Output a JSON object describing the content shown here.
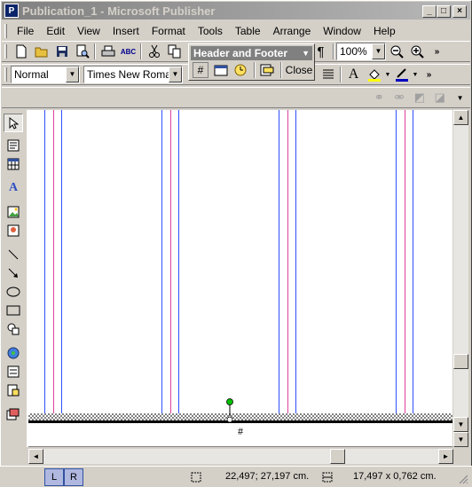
{
  "window": {
    "title": "Publication_1 - Microsoft Publisher",
    "app_icon": "publisher-icon",
    "controls": [
      "minimize",
      "maximize",
      "close"
    ]
  },
  "menu": [
    "File",
    "Edit",
    "View",
    "Insert",
    "Format",
    "Tools",
    "Table",
    "Arrange",
    "Window",
    "Help"
  ],
  "standard_toolbar": {
    "icons": [
      "new-icon",
      "open-icon",
      "save-icon",
      "print-preview-icon",
      "print-icon",
      "spelling-icon",
      "cut-icon",
      "copy-icon"
    ],
    "pilcrow": "¶",
    "zoom": "100%"
  },
  "formatting_toolbar": {
    "style": "Normal",
    "font": "Times New Roman"
  },
  "header_footer_toolbar": {
    "title": "Header and Footer",
    "close_label": "Close",
    "icons": [
      "insert-page-number-icon",
      "insert-date-icon",
      "insert-time-icon",
      "show-header-footer-icon"
    ]
  },
  "page": {
    "footer_text": "#"
  },
  "page_tabs": [
    "L",
    "R"
  ],
  "status": {
    "position": "22,497; 27,197 cm.",
    "size": "17,497 x 0,762 cm."
  },
  "colors": {
    "margin_guide": "#3050ff",
    "column_guide": "#e040a0",
    "rotate_handle": "#00c000"
  }
}
